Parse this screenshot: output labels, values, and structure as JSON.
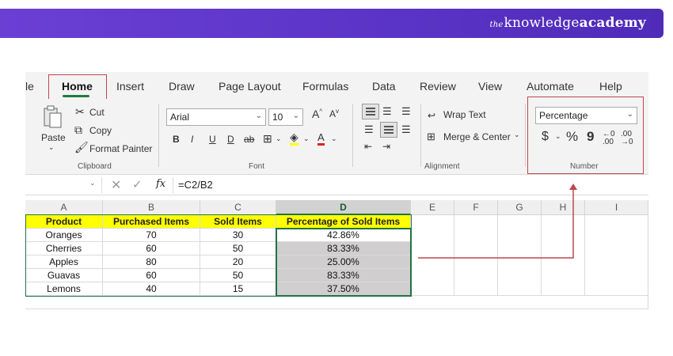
{
  "brand": {
    "prefix": "the",
    "name_regular": "knowledge",
    "name_bold": "academy"
  },
  "tabs": [
    {
      "label": "le"
    },
    {
      "label": "Home",
      "active": true
    },
    {
      "label": "Insert"
    },
    {
      "label": "Draw"
    },
    {
      "label": "Page Layout"
    },
    {
      "label": "Formulas"
    },
    {
      "label": "Data"
    },
    {
      "label": "Review"
    },
    {
      "label": "View"
    },
    {
      "label": "Automate"
    },
    {
      "label": "Help"
    }
  ],
  "ribbon": {
    "clipboard": {
      "paste": "Paste",
      "cut": "Cut",
      "copy": "Copy",
      "format_painter": "Format Painter",
      "group": "Clipboard"
    },
    "font": {
      "family": "Arial",
      "size": "10",
      "group": "Font",
      "bold": "B",
      "italic": "I",
      "underline": "U",
      "double_underline": "D",
      "strike": "ab",
      "font_color": "A"
    },
    "alignment": {
      "wrap_text": "Wrap Text",
      "merge_center": "Merge & Center",
      "group": "Alignment"
    },
    "number": {
      "format": "Percentage",
      "group": "Number",
      "currency": "$",
      "percent": "%",
      "comma": "9"
    }
  },
  "formula_bar": {
    "fx": "fx",
    "formula": "=C2/B2"
  },
  "columns": [
    "A",
    "B",
    "C",
    "D",
    "E",
    "F",
    "G",
    "H",
    "I"
  ],
  "table": {
    "headers": [
      "Product",
      "Purchased Items",
      "Sold Items",
      "Percentage of Sold Items"
    ],
    "rows": [
      [
        "Oranges",
        "70",
        "30",
        "42.86%"
      ],
      [
        "Cherries",
        "60",
        "50",
        "83.33%"
      ],
      [
        "Apples",
        "80",
        "20",
        "25.00%"
      ],
      [
        "Guavas",
        "60",
        "50",
        "83.33%"
      ],
      [
        "Lemons",
        "40",
        "15",
        "37.50%"
      ]
    ]
  },
  "colors": {
    "banner": "#5a34c6",
    "excel_green": "#217346",
    "highlight_red": "#c0474f",
    "header_yellow": "#ffff00",
    "selection_gray": "#d0cece"
  }
}
